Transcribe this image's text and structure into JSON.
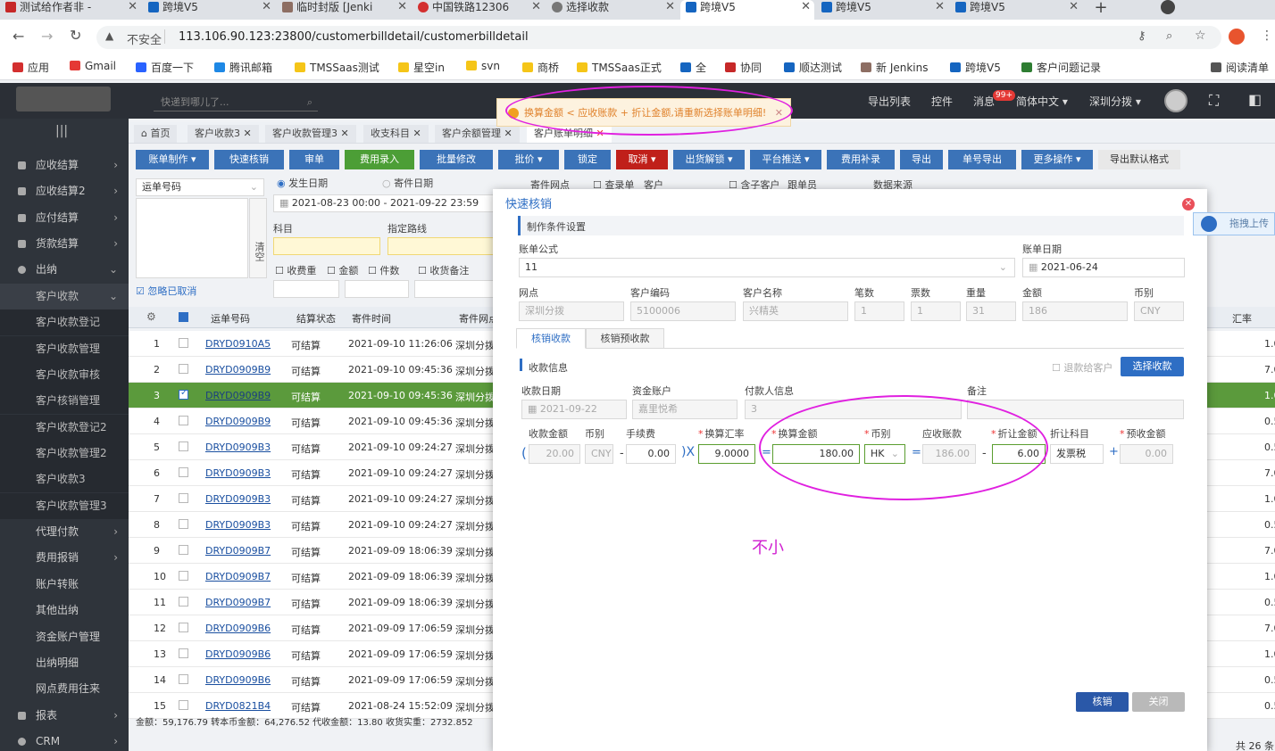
{
  "browser": {
    "tabs": [
      {
        "label": "测试给作者非 -",
        "active": false
      },
      {
        "label": "跨境V5",
        "active": false
      },
      {
        "label": "临时封版 [Jenki",
        "active": false
      },
      {
        "label": "中国铁路12306",
        "active": false
      },
      {
        "label": "选择收款",
        "active": false
      },
      {
        "label": "跨境V5",
        "active": true
      },
      {
        "label": "跨境V5",
        "active": false
      },
      {
        "label": "跨境V5",
        "active": false
      }
    ],
    "security_label": "不安全",
    "url": "113.106.90.123:23800/customerbilldetail/customerbilldetail",
    "bookmarks": [
      "应用",
      "Gmail",
      "百度一下",
      "腾讯邮箱",
      "TMSSaas测试",
      "星空in",
      "svn",
      "商桥",
      "TMSSaas正式",
      "全",
      "协同",
      "顺达测试",
      "新 Jenkins",
      "跨境V5",
      "客户问题记录"
    ],
    "reading_list": "阅读清单"
  },
  "header": {
    "search_placeholder": "快递到哪儿了...",
    "export_list": "导出列表",
    "controls": "控件",
    "messages": "消息",
    "messages_badge": "99+",
    "language": "简体中文 ▾",
    "branch": "深圳分拨 ▾"
  },
  "toast": {
    "message": "换算金额 < 应收账款 + 折让金额,请重新选择账单明细!"
  },
  "sidebar": {
    "items": [
      {
        "label": "应收结算"
      },
      {
        "label": "应收结算2"
      },
      {
        "label": "应付结算"
      },
      {
        "label": "货款结算"
      },
      {
        "label": "出纳"
      }
    ],
    "sub_items": [
      "客户收款",
      "客户收款登记",
      "客户收款管理",
      "客户收款审核",
      "客户核销管理",
      "客户收款登记2",
      "客户收款管理2",
      "客户收款3",
      "客户收款管理3",
      "代理付款",
      "费用报销",
      "账户转账",
      "其他出纳",
      "资金账户管理",
      "出纳明细",
      "网点费用往来"
    ],
    "bottom_items": [
      "报表",
      "CRM"
    ]
  },
  "page_tabs": [
    "首页",
    "客户收款3",
    "客户收款管理3",
    "收支科目",
    "客户余额管理",
    "客户账单明细"
  ],
  "toolbar": [
    "账单制作 ▾",
    "快速核销",
    "审单",
    "费用录入",
    "批量修改",
    "批价 ▾",
    "锁定",
    "取消 ▾",
    "出货解锁 ▾",
    "平台推送 ▾",
    "费用补录",
    "导出",
    "单号导出",
    "更多操作 ▾",
    "导出默认格式"
  ],
  "filters": {
    "waybill_select": "运单号码",
    "clear": "清空",
    "ship_date": "发生日期",
    "send_date": "寄件日期",
    "date_range": "2021-08-23 00:00  -  2021-09-22 23:59",
    "subject": "科目",
    "route": "指定路线",
    "fee_received": "收费重",
    "amount": "金额",
    "pieces": "件数",
    "fee_remark": "收货备注",
    "ignore_cancel": "忽略已取消",
    "send_point": "寄件网点",
    "record_sheet": "查录单",
    "customer": "客户",
    "sub_customer": "含子客户",
    "follower": "跟单员",
    "data_source": "数据来源"
  },
  "table": {
    "headers": [
      "运单号码",
      "结算状态",
      "寄件时间",
      "寄件网点",
      "汇率"
    ],
    "rows": [
      {
        "no": "1",
        "waybill": "DRYD0910A5",
        "status": "可结算",
        "time": "2021-09-10 11:26:06",
        "point": "深圳分拨",
        "rate": "1.00",
        "checked": false
      },
      {
        "no": "2",
        "waybill": "DRYD0909B9",
        "status": "可结算",
        "time": "2021-09-10 09:45:36",
        "point": "深圳分拨",
        "rate": "7.00",
        "checked": false
      },
      {
        "no": "3",
        "waybill": "DRYD0909B9",
        "status": "可结算",
        "time": "2021-09-10 09:45:36",
        "point": "深圳分拨",
        "rate": "1.00",
        "checked": true
      },
      {
        "no": "4",
        "waybill": "DRYD0909B9",
        "status": "可结算",
        "time": "2021-09-10 09:45:36",
        "point": "深圳分拨",
        "rate": "0.50",
        "checked": false
      },
      {
        "no": "5",
        "waybill": "DRYD0909B3",
        "status": "可结算",
        "time": "2021-09-10 09:24:27",
        "point": "深圳分拨",
        "rate": "0.50",
        "checked": false
      },
      {
        "no": "6",
        "waybill": "DRYD0909B3",
        "status": "可结算",
        "time": "2021-09-10 09:24:27",
        "point": "深圳分拨",
        "rate": "7.00",
        "checked": false
      },
      {
        "no": "7",
        "waybill": "DRYD0909B3",
        "status": "可结算",
        "time": "2021-09-10 09:24:27",
        "point": "深圳分拨",
        "rate": "1.00",
        "checked": false
      },
      {
        "no": "8",
        "waybill": "DRYD0909B3",
        "status": "可结算",
        "time": "2021-09-10 09:24:27",
        "point": "深圳分拨",
        "rate": "0.50",
        "checked": false
      },
      {
        "no": "9",
        "waybill": "DRYD0909B7",
        "status": "可结算",
        "time": "2021-09-09 18:06:39",
        "point": "深圳分拨",
        "rate": "7.00",
        "checked": false
      },
      {
        "no": "10",
        "waybill": "DRYD0909B7",
        "status": "可结算",
        "time": "2021-09-09 18:06:39",
        "point": "深圳分拨",
        "rate": "1.00",
        "checked": false
      },
      {
        "no": "11",
        "waybill": "DRYD0909B7",
        "status": "可结算",
        "time": "2021-09-09 18:06:39",
        "point": "深圳分拨",
        "rate": "0.50",
        "checked": false
      },
      {
        "no": "12",
        "waybill": "DRYD0909B6",
        "status": "可结算",
        "time": "2021-09-09 17:06:59",
        "point": "深圳分拨",
        "rate": "7.00",
        "checked": false
      },
      {
        "no": "13",
        "waybill": "DRYD0909B6",
        "status": "可结算",
        "time": "2021-09-09 17:06:59",
        "point": "深圳分拨",
        "rate": "1.00",
        "checked": false
      },
      {
        "no": "14",
        "waybill": "DRYD0909B6",
        "status": "可结算",
        "time": "2021-09-09 17:06:59",
        "point": "深圳分拨",
        "rate": "0.50",
        "checked": false
      },
      {
        "no": "15",
        "waybill": "DRYD0821B4",
        "status": "可结算",
        "time": "2021-08-24 15:52:09",
        "point": "深圳分拨",
        "rate": "0.50",
        "checked": false
      }
    ],
    "footer": "金额：59,176.79  转本币金额：64,276.52  代收金额：13.80  收货实重：2732.852",
    "total": "共 26 条"
  },
  "modal": {
    "title": "快速核销",
    "section1": "制作条件设置",
    "bill_formula_label": "账单公式",
    "bill_formula_value": "11",
    "bill_date_label": "账单日期",
    "bill_date_value": "2021-06-24",
    "point_label": "网点",
    "point_value": "深圳分拨",
    "customer_code_label": "客户编码",
    "customer_code_value": "5100006",
    "customer_name_label": "客户名称",
    "customer_name_value": "兴精英",
    "count_label": "笔数",
    "count_value": "1",
    "tickets_label": "票数",
    "tickets_value": "1",
    "weight_label": "重量",
    "weight_value": "31",
    "amount_label": "金额",
    "amount_value": "186",
    "currency_label": "币别",
    "currency_value": "CNY",
    "tab_active": "核销收款",
    "tab_other": "核销预收款",
    "section2": "收款信息",
    "refund_label": "退款给客户",
    "select_btn": "选择收款",
    "recv_date_label": "收款日期",
    "recv_date_value": "2021-09-22",
    "account_label": "资金账户",
    "account_value": "嘉里悦希",
    "payer_label": "付款人信息",
    "payer_value": "3",
    "remark_label": "备注",
    "recv_amount_label": "收款金额",
    "recv_amount_value": "20.00",
    "recv_currency_label": "币别",
    "recv_currency_value": "CNY",
    "fee_label": "手续费",
    "fee_value": "0.00",
    "rate_label": "换算汇率",
    "rate_value": "9.0000",
    "conv_amount_label": "换算金额",
    "conv_amount_value": "180.00",
    "conv_currency_label": "币别",
    "conv_currency_value": "HK",
    "receivable_label": "应收账款",
    "receivable_value": "186.00",
    "discount_label": "折让金额",
    "discount_value": "6.00",
    "discount_subject_label": "折让科目",
    "discount_subject_value": "发票税",
    "prepaid_label": "预收金额",
    "prepaid_value": "0.00",
    "op_paren_open": "(",
    "op_minus": "-",
    "op_times": ")X",
    "op_eq": "=",
    "op_eq2": "=",
    "op_minus2": "-",
    "op_plus": "+",
    "annotation": "不小",
    "confirm_btn": "核销",
    "close_btn": "关闭"
  },
  "side_badge": "拖拽上传"
}
